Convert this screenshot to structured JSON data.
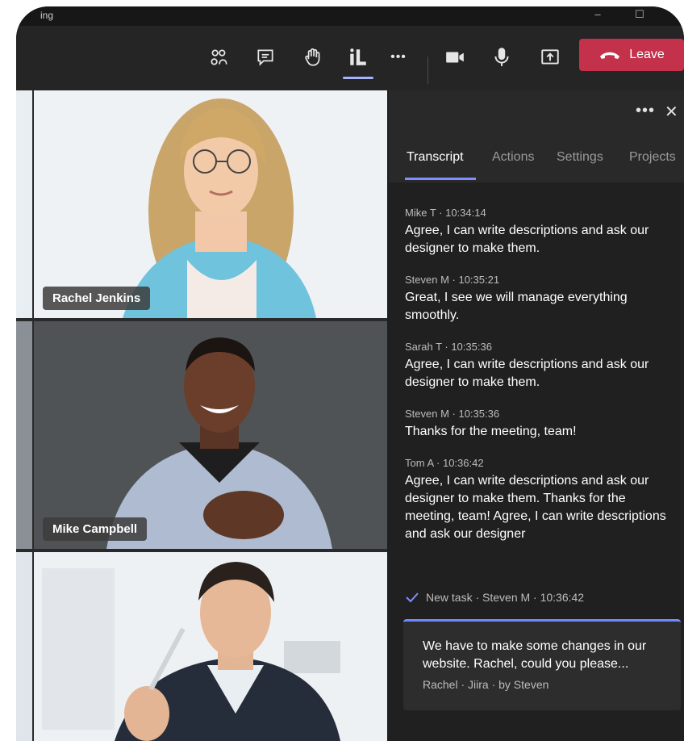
{
  "window": {
    "title": "ing",
    "minimize_label": "–",
    "maximize_label": "☐"
  },
  "toolbar": {
    "icons": [
      "people-icon",
      "chat-icon",
      "raise-hand-icon",
      "apps-icon",
      "more-icon",
      "camera-icon",
      "mic-icon",
      "share-icon"
    ],
    "more_label": "•••",
    "leave_label": "Leave",
    "leave_color": "#c4314b"
  },
  "participants": [
    {
      "name": "Rachel Jenkins"
    },
    {
      "name": "Mike Campbell"
    },
    {
      "name": ""
    }
  ],
  "panel": {
    "more_label": "•••",
    "close_label": "✕",
    "tabs": [
      "Transcript",
      "Actions",
      "Settings",
      "Projects"
    ],
    "active_tab": "Transcript",
    "accent_color": "#7f8fff",
    "messages": [
      {
        "meta": "Mike T · 10:34:14",
        "text": "Agree, I can write descriptions and ask our designer to make them."
      },
      {
        "meta": "Steven M · 10:35:21",
        "text": "Great, I see we will manage everything smoothly."
      },
      {
        "meta": "Sarah T · 10:35:36",
        "text": "Agree, I can write descriptions and ask our designer to make them."
      },
      {
        "meta": "Steven M · 10:35:36",
        "text": "Thanks for the meeting, team!"
      },
      {
        "meta": "Tom A · 10:36:42",
        "text": "Agree, I can write descriptions and ask our designer to make them. Thanks for the meeting, team! Agree, I can write descriptions and ask our designer"
      }
    ],
    "task_line": "New task · Steven M · 10:36:42",
    "task_card": {
      "text": "We have to make some changes in our website. Rachel, could you please...",
      "meta": "Rachel · Jiira · by Steven"
    }
  }
}
